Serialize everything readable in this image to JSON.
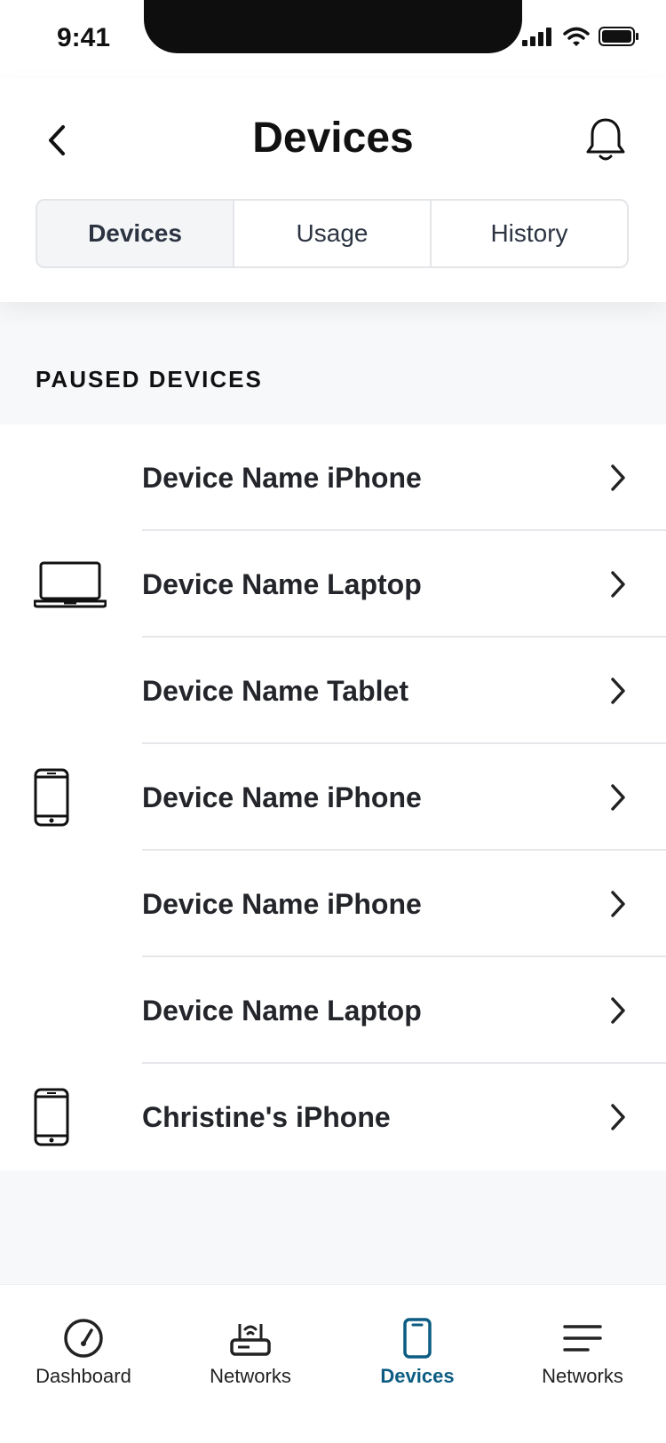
{
  "status_bar": {
    "time": "9:41"
  },
  "header": {
    "title": "Devices"
  },
  "segments": [
    {
      "label": "Devices",
      "active": true
    },
    {
      "label": "Usage",
      "active": false
    },
    {
      "label": "History",
      "active": false
    }
  ],
  "section": {
    "title": "PAUSED DEVICES"
  },
  "devices": [
    {
      "name": "Device Name iPhone",
      "icon": "none"
    },
    {
      "name": "Device Name Laptop",
      "icon": "laptop-icon"
    },
    {
      "name": "Device Name Tablet",
      "icon": "none"
    },
    {
      "name": "Device Name iPhone",
      "icon": "phone-icon"
    },
    {
      "name": "Device Name iPhone",
      "icon": "none"
    },
    {
      "name": "Device Name Laptop",
      "icon": "none"
    },
    {
      "name": "Christine's iPhone",
      "icon": "phone-icon"
    }
  ],
  "tabbar": {
    "items": [
      {
        "label": "Dashboard",
        "icon": "speedometer-icon",
        "active": false
      },
      {
        "label": "Networks",
        "icon": "router-icon",
        "active": false
      },
      {
        "label": "Devices",
        "icon": "device-icon",
        "active": true
      },
      {
        "label": "Networks",
        "icon": "menu-icon",
        "active": false
      }
    ]
  },
  "colors": {
    "accent": "#0c5c83",
    "background": "#f7f8fa",
    "divider": "#e6e7ea"
  }
}
